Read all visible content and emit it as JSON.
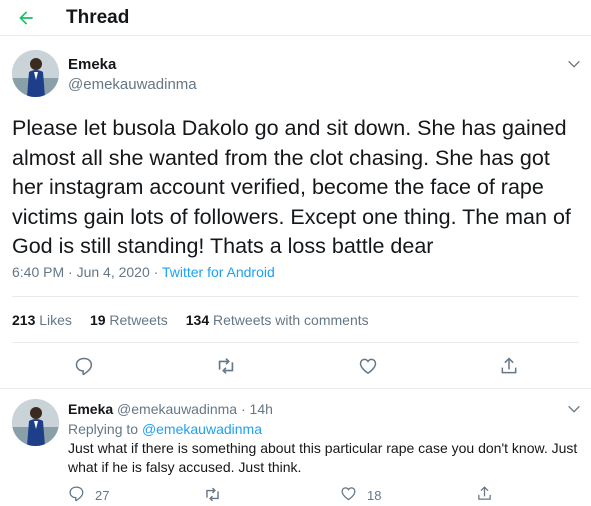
{
  "header": {
    "title": "Thread"
  },
  "main_tweet": {
    "name": "Emeka",
    "handle": "@emekauwadinma",
    "text": "Please let busola Dakolo go and sit down. She has gained almost all she wanted from the clot chasing. She has got her instagram account verified, become the face of rape victims gain lots of followers. Except one thing. The man of God is still standing! Thats a loss battle dear",
    "time": "6:40 PM · Jun 4, 2020 · ",
    "source": "Twitter for Android",
    "stats": {
      "likes_count": "213",
      "likes_label": "Likes",
      "retweets_count": "19",
      "retweets_label": "Retweets",
      "comments_count": "134",
      "comments_label": "Retweets with comments"
    }
  },
  "reply_tweet": {
    "name": "Emeka",
    "handle_time": "@emekauwadinma · 14h",
    "replying_prefix": "Replying to ",
    "replying_to": "@emekauwadinma",
    "text": "Just what if there is something about this particular rape case you don't know. Just what if he is falsy accused. Just think.",
    "reply_count": "27",
    "like_count": "18"
  },
  "colors": {
    "accent": "#1da1f2",
    "back_arrow": "#17bf63",
    "secondary_text": "#657786",
    "divider": "#e6ecf0"
  }
}
